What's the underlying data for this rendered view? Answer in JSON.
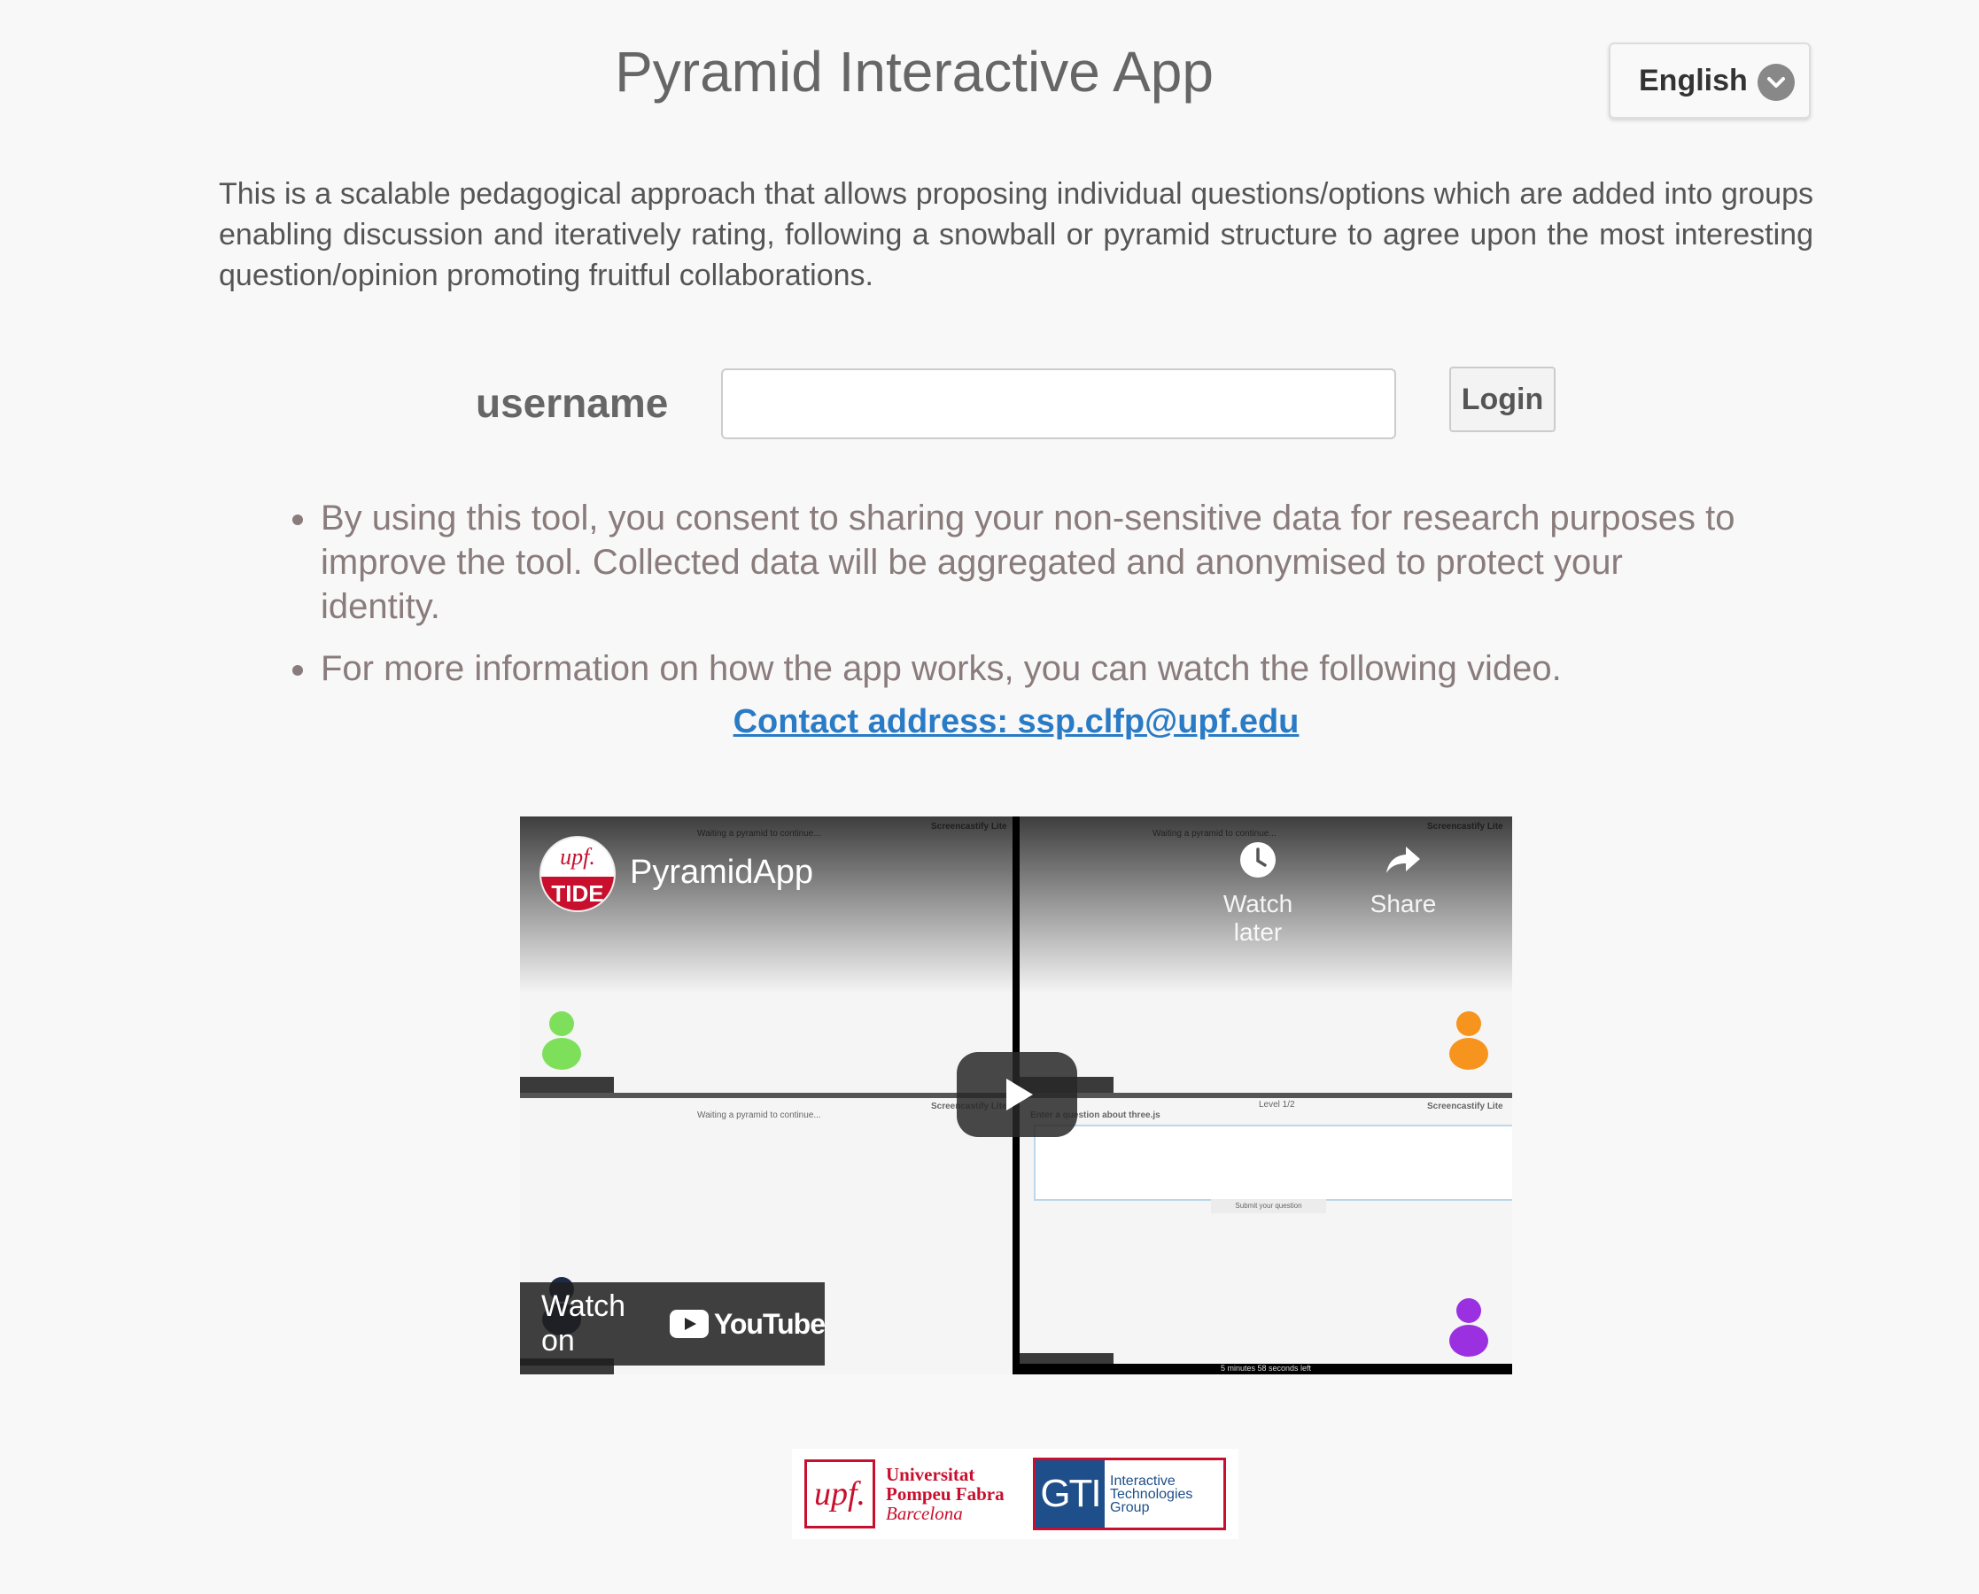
{
  "header": {
    "title": "Pyramid Interactive App",
    "language": "English"
  },
  "intro": "This is a scalable pedagogical approach that allows proposing individual questions/options which are added into groups enabling discussion and iteratively rating, following a snowball or pyramid structure to agree upon the most interesting question/opinion promoting fruitful collaborations.",
  "login": {
    "label": "username",
    "value": "",
    "button": "Login"
  },
  "info": [
    "By using this tool, you consent to sharing your non-sensitive data for research purposes to improve the tool. Collected data will be aggregated and anonymised to protect your identity.",
    "For more information on how the app works, you can watch the following video."
  ],
  "contact": {
    "label": "Contact address: ssp.clfp@upf.edu"
  },
  "video": {
    "channel_logo_top": "upf.",
    "channel_logo_bottom": "TIDE",
    "title": "PyramidApp",
    "watch_later": "Watch later",
    "share": "Share",
    "watch_on": "Watch on",
    "youtube": "YouTube",
    "inner_waiting": "Waiting a pyramid to continue...",
    "inner_recorder": "Screencastify Lite",
    "inner_question_prompt": "Enter a question about three.js",
    "inner_submit": "Submit your question",
    "inner_timer": "5 minutes 58 seconds left",
    "inner_level": "Level 1/2",
    "avatar_colors": [
      "#7ee05a",
      "#f7941d",
      "#9b30e0",
      "#1e2a4a"
    ]
  },
  "footer": {
    "upf_mark": "upf.",
    "upf_line1": "Universitat",
    "upf_line2": "Pompeu Fabra",
    "upf_line3": "Barcelona",
    "gti_mark": "GTI",
    "gti_line1": "Interactive",
    "gti_line2": "Technologies",
    "gti_line3": "Group"
  },
  "colors": {
    "background": "#f8f8f8",
    "link": "#2a7bc6",
    "upf_red": "#c8102e",
    "gti_blue": "#1e4f8a"
  }
}
